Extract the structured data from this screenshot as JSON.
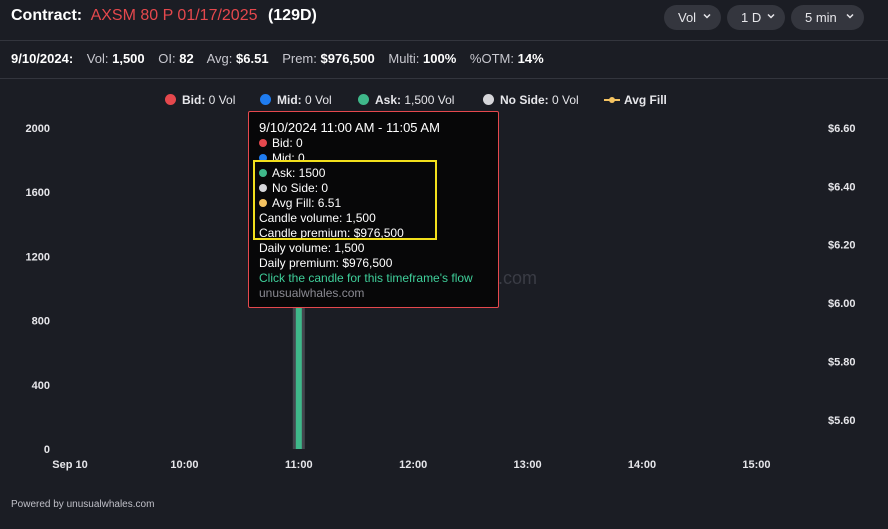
{
  "header": {
    "contract_label": "Contract:",
    "contract": "AXSM 80 P 01/17/2025",
    "days": "(129D)",
    "dropdowns": [
      {
        "label": "Vol"
      },
      {
        "label": "1 D"
      },
      {
        "label": "5 min"
      }
    ]
  },
  "stats": {
    "date": "9/10/2024:",
    "vol_label": "Vol:",
    "vol": "1,500",
    "oi_label": "OI:",
    "oi": "82",
    "avg_label": "Avg:",
    "avg": "$6.51",
    "prem_label": "Prem:",
    "prem": "$976,500",
    "multi_label": "Multi:",
    "multi": "100%",
    "otm_label": "%OTM:",
    "otm": "14%"
  },
  "legend": [
    {
      "name": "Bid:",
      "value": "0 Vol",
      "color": "#e5484d"
    },
    {
      "name": "Mid:",
      "value": "0 Vol",
      "color": "#1f7cf0"
    },
    {
      "name": "Ask:",
      "value": "1,500 Vol",
      "color": "#3fb88a"
    },
    {
      "name": "No Side:",
      "value": "0 Vol",
      "color": "#d6d6da"
    },
    {
      "name": "Avg Fill",
      "value": "",
      "color": "#f5c361"
    }
  ],
  "chart_data": {
    "type": "bar",
    "x_ticks": [
      "Sep 10",
      "10:00",
      "11:00",
      "12:00",
      "13:00",
      "14:00",
      "15:00"
    ],
    "ylim": [
      0,
      2000
    ],
    "y_ticks": [
      "2000",
      "1600",
      "1200",
      "800",
      "400",
      "0"
    ],
    "y2lim": [
      5.5,
      6.6
    ],
    "y2_ticks": [
      "$6.60",
      "$6.40",
      "$6.20",
      "$6.00",
      "$5.80",
      "$5.60"
    ],
    "series": [
      {
        "name": "Ask",
        "color": "#3fb88a",
        "points": [
          {
            "x": "11:00",
            "value": 1500
          }
        ]
      },
      {
        "name": "Avg Fill",
        "color": "#f5c361",
        "points": [
          {
            "x": "11:00",
            "value": 6.51
          }
        ]
      }
    ]
  },
  "tooltip": {
    "title": "9/10/2024 11:00 AM - 11:05 AM",
    "bid": "Bid: 0",
    "mid": "Mid: 0",
    "ask": "Ask: 1500",
    "no_side": "No Side: 0",
    "avg_fill": "Avg Fill: 6.51",
    "candle_volume": "Candle volume: 1,500",
    "candle_premium": "Candle premium: $976,500",
    "daily_volume": "Daily volume: 1,500",
    "daily_premium": "Daily premium: $976,500",
    "link": "Click the candle for this timeframe's flow",
    "watermark": "unusualwhales.com"
  },
  "watermark_tail": ".com",
  "footer": "Powered by unusualwhales.com"
}
